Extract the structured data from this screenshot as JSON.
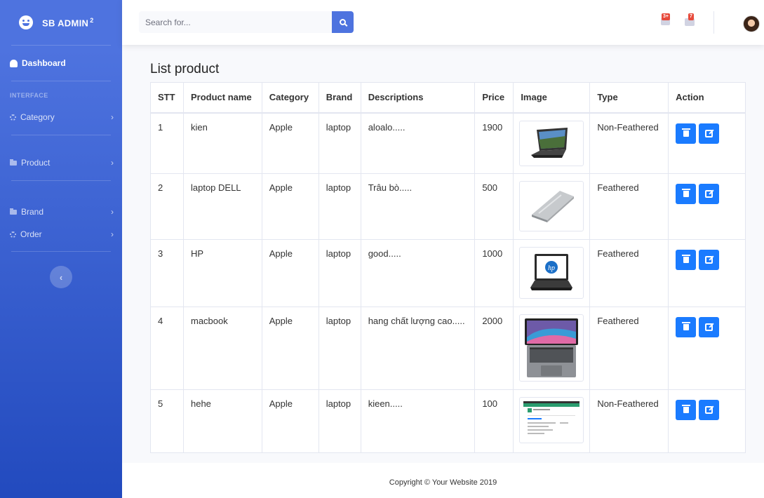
{
  "sidebar": {
    "brand": "SB ADMIN",
    "brand_sup": "2",
    "dashboard": "Dashboard",
    "heading": "INTERFACE",
    "items": [
      {
        "label": "Category"
      },
      {
        "label": "Product"
      },
      {
        "label": "Brand"
      },
      {
        "label": "Order"
      }
    ],
    "toggle_glyph": "‹"
  },
  "topbar": {
    "search_placeholder": "Search for...",
    "alerts_badge": "3+",
    "messages_badge": "7"
  },
  "page": {
    "title": "List product"
  },
  "table": {
    "headers": [
      "STT",
      "Product name",
      "Category",
      "Brand",
      "Descriptions",
      "Price",
      "Image",
      "Type",
      "Action"
    ],
    "rows": [
      {
        "stt": "1",
        "name": "kien",
        "category": "Apple",
        "brand": "laptop",
        "desc": "aloalo.....",
        "price": "1900",
        "type": "Non-Feathered"
      },
      {
        "stt": "2",
        "name": "laptop DELL",
        "category": "Apple",
        "brand": "laptop",
        "desc": "Trâu bò.....",
        "price": "500",
        "type": "Feathered"
      },
      {
        "stt": "3",
        "name": "HP",
        "category": "Apple",
        "brand": "laptop",
        "desc": "good.....",
        "price": "1000",
        "type": "Feathered"
      },
      {
        "stt": "4",
        "name": "macbook",
        "category": "Apple",
        "brand": "laptop",
        "desc": "hang chất lượng cao.....",
        "price": "2000",
        "type": "Feathered"
      },
      {
        "stt": "5",
        "name": "hehe",
        "category": "Apple",
        "brand": "laptop",
        "desc": "kieen.....",
        "price": "100",
        "type": "Non-Feathered"
      }
    ]
  },
  "footer": {
    "text": "Copyright © Your Website 2019"
  },
  "colors": {
    "primary": "#4e73df",
    "action_button": "#1a7bff",
    "badge": "#e74a3b"
  }
}
